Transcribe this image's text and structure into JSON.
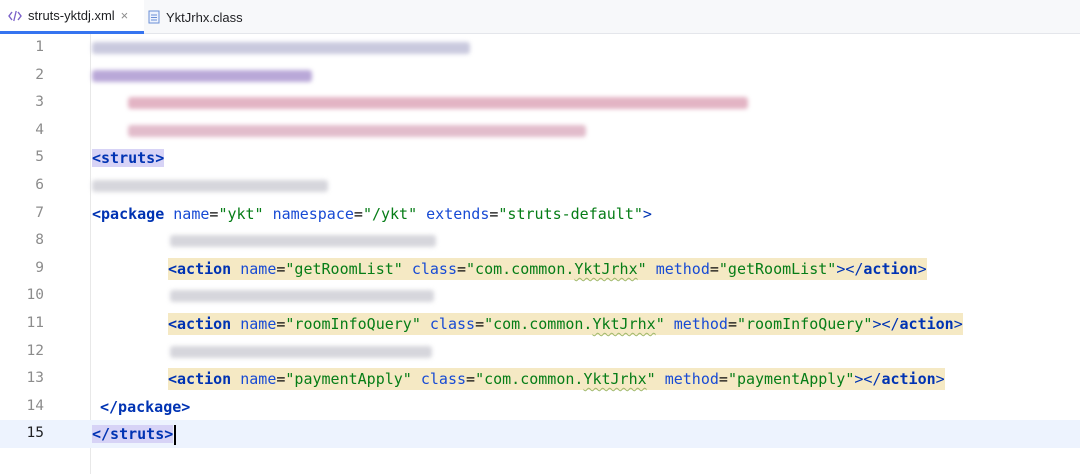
{
  "tabs": [
    {
      "label": "struts-yktdj.xml",
      "active": true,
      "icon": "xml-code-icon",
      "close": "×"
    },
    {
      "label": "YktJrhx.class",
      "active": false,
      "icon": "class-file-icon"
    }
  ],
  "line_numbers": [
    "1",
    "2",
    "3",
    "4",
    "5",
    "6",
    "7",
    "8",
    "9",
    "10",
    "11",
    "12",
    "13",
    "14",
    "15"
  ],
  "current_line": "15",
  "code": {
    "l5": {
      "tag": "<struts>"
    },
    "l7": {
      "open": "<package",
      "a1": "name",
      "v1": "\"ykt\"",
      "a2": "namespace",
      "v2": "\"/ykt\"",
      "a3": "extends",
      "v3": "\"struts-default\"",
      "close": ">"
    },
    "actions": [
      {
        "open": "<action",
        "a1": "name",
        "v1": "\"getRoomList\"",
        "a2": "class",
        "v2pre": "\"com.common.",
        "v2cls": "YktJrhx",
        "v2post": "\"",
        "a3": "method",
        "v3": "\"getRoomList\"",
        "end_open": "></",
        "end_tag": "action",
        "end_close": ">"
      },
      {
        "open": "<action",
        "a1": "name",
        "v1": "\"roomInfoQuery\"",
        "a2": "class",
        "v2pre": "\"com.common.",
        "v2cls": "YktJrhx",
        "v2post": "\"",
        "a3": "method",
        "v3": "\"roomInfoQuery\"",
        "end_open": "></",
        "end_tag": "action",
        "end_close": ">"
      },
      {
        "open": "<action",
        "a1": "name",
        "v1": "\"paymentApply\"",
        "a2": "class",
        "v2pre": "\"com.common.",
        "v2cls": "YktJrhx",
        "v2post": "\"",
        "a3": "method",
        "v3": "\"paymentApply\"",
        "end_open": "></",
        "end_tag": "action",
        "end_close": ">"
      }
    ],
    "l14": {
      "tag": "</package>"
    },
    "l15": {
      "tag": "</struts>"
    }
  },
  "colors": {
    "tag": "#0033b3",
    "attr_name": "#174ad4",
    "attr_value": "#067d17",
    "highlight": "#f5e9c4",
    "tag_match": "#d7d3f6",
    "current_line": "#edf3fe",
    "tab_accent": "#3574f0"
  }
}
